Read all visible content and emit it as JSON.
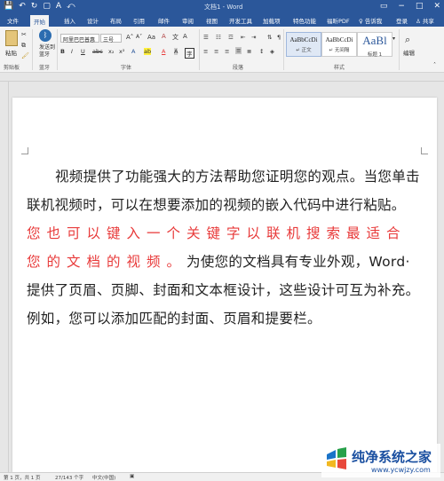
{
  "titlebar": {
    "title": "文档1 - Word",
    "qat": [
      "💾",
      "↶",
      "↻",
      "▢",
      "A",
      "⤺"
    ]
  },
  "tabs": [
    "文件",
    "开始",
    "插入",
    "设计",
    "布局",
    "引用",
    "邮件",
    "审阅",
    "视图",
    "开发工具",
    "加载项",
    "特色功能",
    "福昕PDF"
  ],
  "tell_me": "♀ 告诉我",
  "login": "登录",
  "share": "共享",
  "ribbon": {
    "paste_label": "粘贴",
    "bluetooth_label": "发送到蓝牙",
    "font_name": "阿里巴巴普惠",
    "font_size": "三号",
    "styles": [
      {
        "sample": "AaBbCcDi",
        "name": "↵ 正文"
      },
      {
        "sample": "AaBbCcDi",
        "name": "↵ 无间隔"
      },
      {
        "sample": "AaBl",
        "name": "标题 1"
      }
    ],
    "edit_label": "编辑",
    "groups": [
      "剪贴板",
      "蓝牙",
      "字体",
      "段落",
      "样式"
    ]
  },
  "document": {
    "text_before": "视频提供了功能强大的方法帮助您证明您的观点。当您单击联机视频时，可以在想要添加的视频的嵌入代码中进行粘贴。",
    "text_red": "您也可以键入一个关键字以联机搜索最适合您的文档的视频。",
    "text_after": "为使您的文档具有专业外观，Word· 提供了页眉、页脚、封面和文本框设计，这些设计可互为补充。例如，您可以添加匹配的封面、页眉和提要栏。",
    "colors": {
      "red_text": "#e83a3a"
    }
  },
  "statusbar": {
    "page": "第 1 页，共 1 页",
    "words": "27/143 个字",
    "lang": "中文(中国)"
  },
  "watermark": {
    "title": "纯净系统之家",
    "url": "www.ycwjzy.com"
  }
}
